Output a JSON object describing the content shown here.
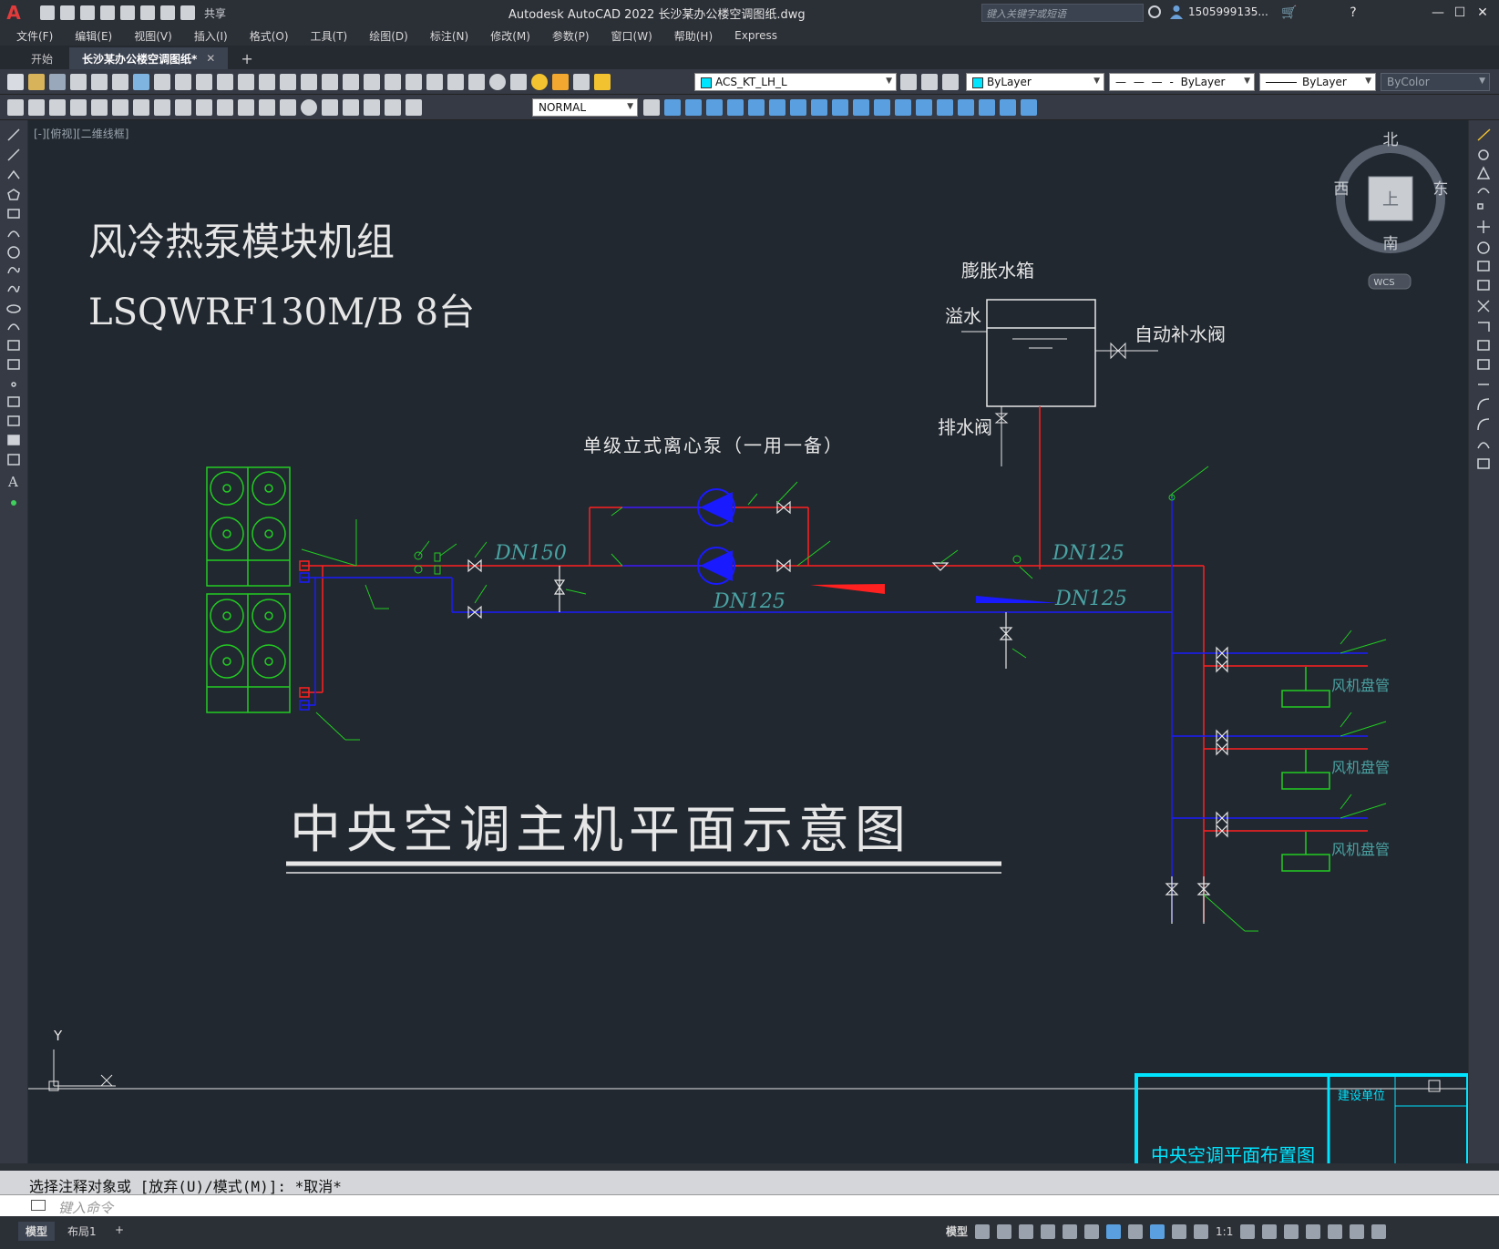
{
  "app": {
    "title": "Autodesk AutoCAD 2022    长沙某办公楼空调图纸.dwg",
    "logo": "A",
    "share_label": "共享",
    "search_placeholder": "键入关键字或短语",
    "user_name": "1505999135...",
    "accent": "#e23b3b"
  },
  "menu": [
    "文件(F)",
    "编辑(E)",
    "视图(V)",
    "插入(I)",
    "格式(O)",
    "工具(T)",
    "绘图(D)",
    "标注(N)",
    "修改(M)",
    "参数(P)",
    "窗口(W)",
    "帮助(H)",
    "Express"
  ],
  "tabs": {
    "start": "开始",
    "active": "长沙某办公楼空调图纸*",
    "close": "✕",
    "add": "+"
  },
  "toolbar": {
    "layer": "ACS_KT_LH_L",
    "color": "ByLayer",
    "linetype": "ByLayer",
    "lineweight": "ByLayer",
    "plotstyle": "ByColor",
    "textstyle": "NORMAL"
  },
  "viewport": {
    "label": "[-][俯视][二维线框]",
    "viewcube": {
      "north": "北",
      "south": "南",
      "east": "东",
      "west": "西",
      "top": "上",
      "wcs": "WCS"
    },
    "ucs": {
      "x": "X",
      "y": "Y"
    }
  },
  "drawing": {
    "title_line1": "风冷热泵模块机组",
    "title_line2": "LSQWRF130M/B   8台",
    "expansion_tank": "膨胀水箱",
    "overflow": "溢水",
    "auto_makeup_valve": "自动补水阀",
    "drain_valve": "排水阀",
    "pump_label": "单级立式离心泵（一用一备）",
    "dn150": "DN150",
    "dn125_a": "DN125",
    "dn125_b": "DN125",
    "dn125_c": "DN125",
    "fan_coil_1": "风机盘管",
    "fan_coil_2": "风机盘管",
    "fan_coil_3": "风机盘管",
    "main_title": "中央空调主机平面示意图",
    "titleblock_name": "中央空调平面布置图",
    "titleblock_unit": "建设单位"
  },
  "command": {
    "history": "选择注释对象或 [放弃(U)/模式(M)]: *取消*",
    "placeholder": "键入命令"
  },
  "status": {
    "model_tab": "模型",
    "layout_tab": "布局1",
    "add": "+",
    "model_label": "模型",
    "scale": "1:1"
  },
  "colors": {
    "supply": "#ff2020",
    "return": "#1a1aff",
    "equipment": "#22cc22",
    "annotation": "#e6e6e6",
    "dim_text": "#4aa3a3",
    "titleblock": "#00e5ff"
  }
}
